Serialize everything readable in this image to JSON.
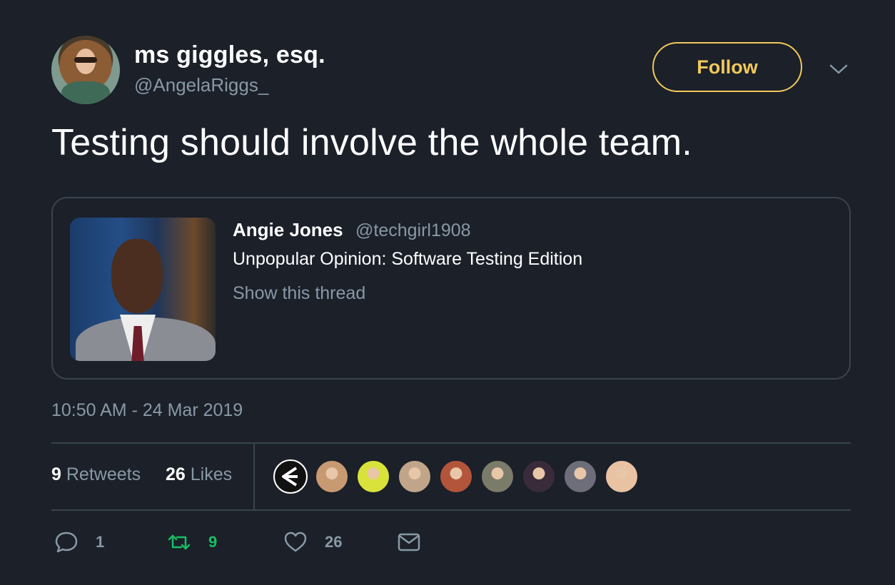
{
  "author": {
    "display_name": "ms giggles, esq.",
    "handle": "@AngelaRiggs_"
  },
  "follow_label": "Follow",
  "tweet_text": "Testing should involve the whole team.",
  "quoted_tweet": {
    "display_name": "Angie Jones",
    "handle": "@techgirl1908",
    "text": "Unpopular Opinion: Software Testing Edition",
    "show_thread": "Show this thread"
  },
  "timestamp": "10:50 AM - 24 Mar 2019",
  "stats": {
    "retweets_count": "9",
    "retweets_label": "Retweets",
    "likes_count": "26",
    "likes_label": "Likes"
  },
  "likers": [
    {
      "color": "#111111",
      "ring": "#ffffff"
    },
    {
      "color": "#c89a72"
    },
    {
      "color": "#d9e23a"
    },
    {
      "color": "#c0a58a"
    },
    {
      "color": "#b2553a"
    },
    {
      "color": "#7b7b6a"
    },
    {
      "color": "#3a2b3a"
    },
    {
      "color": "#6e6e7a"
    },
    {
      "color": "#e8c2a2"
    }
  ],
  "actions": {
    "reply_count": "1",
    "retweet_count": "9",
    "like_count": "26"
  },
  "colors": {
    "background": "#1b2029",
    "accent_follow": "#f1c95a",
    "muted": "#8899a6",
    "retweet_green": "#17bf63",
    "icon_gray": "#8899a6"
  },
  "icons": {
    "reply": "reply-icon",
    "retweet": "retweet-icon",
    "like": "heart-icon",
    "dm": "envelope-icon",
    "more": "chevron-down-icon"
  }
}
